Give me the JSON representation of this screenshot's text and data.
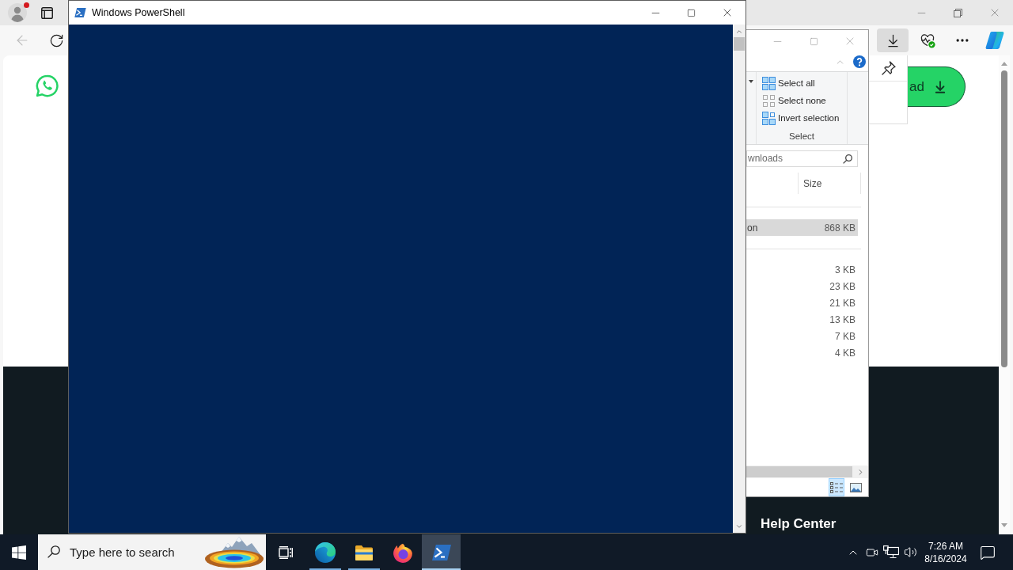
{
  "browser": {
    "profile": {
      "notification": true
    },
    "toolbar": {
      "back_disabled": true,
      "downloads_open": true
    },
    "page": {
      "button_label": "ad",
      "footer_link": "Help Center"
    }
  },
  "explorer": {
    "ribbon_group": {
      "label": "Select",
      "items": [
        {
          "kind": "select-all",
          "label": "Select all"
        },
        {
          "kind": "select-none",
          "label": "Select none"
        },
        {
          "kind": "invert-selection",
          "label": "Invert selection"
        }
      ]
    },
    "search": {
      "placeholder": "wnloads"
    },
    "columns": [
      {
        "label": "Size"
      }
    ],
    "groups": [
      {
        "rows": [
          {
            "column_1": "on",
            "size": "868 KB",
            "selected": true
          }
        ]
      },
      {
        "rows": [
          {
            "size": "3 KB",
            "selected": false
          },
          {
            "size": "23 KB",
            "selected": false
          },
          {
            "size": "21 KB",
            "selected": false
          },
          {
            "size": "13 KB",
            "selected": false
          },
          {
            "size": "7 KB",
            "selected": false
          },
          {
            "size": "4 KB",
            "selected": false
          }
        ]
      }
    ],
    "views": [
      {
        "kind": "details",
        "selected": true
      },
      {
        "kind": "large-icons",
        "selected": false
      }
    ]
  },
  "powershell": {
    "title": "Windows PowerShell"
  },
  "taskbar": {
    "search": {
      "placeholder": "Type here to search"
    },
    "apps": [
      {
        "kind": "edge",
        "running": true,
        "selected": false
      },
      {
        "kind": "explorer",
        "running": true,
        "selected": false
      },
      {
        "kind": "firefox",
        "running": false,
        "selected": false
      },
      {
        "kind": "powershell",
        "running": true,
        "selected": true
      }
    ],
    "clock": {
      "time": "7:26 AM",
      "date": "8/16/2024"
    }
  }
}
